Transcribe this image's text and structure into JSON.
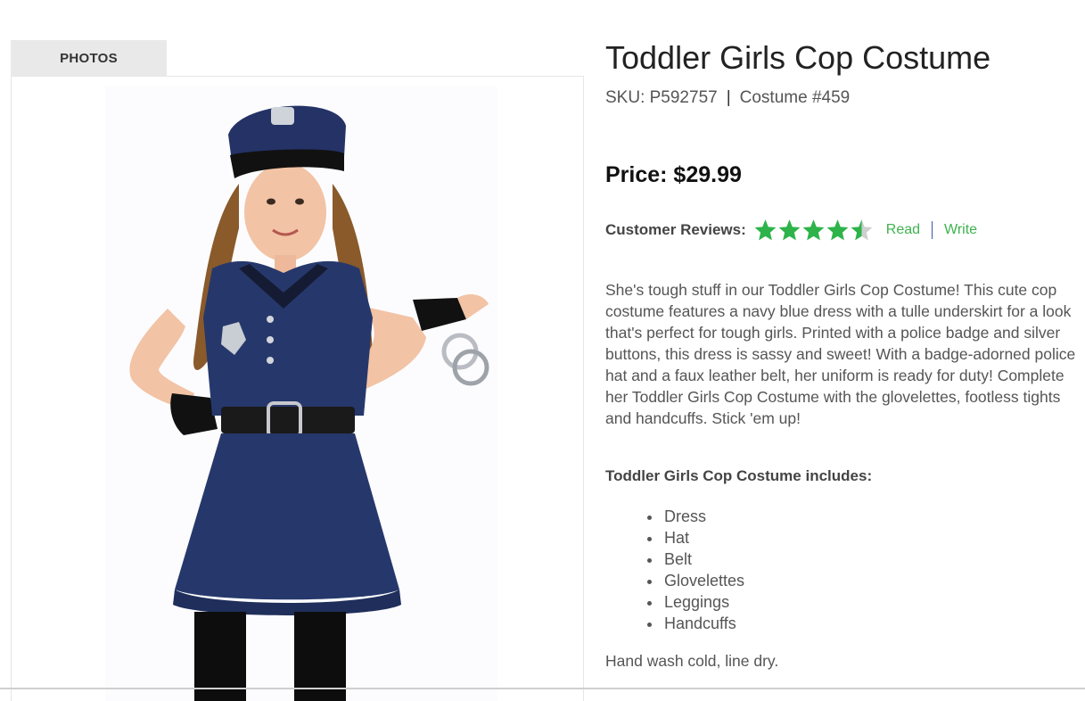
{
  "photos": {
    "tab_label": "PHOTOS",
    "image_alt": "Toddler Girls Cop Costume"
  },
  "product": {
    "title": "Toddler Girls Cop Costume",
    "sku": "SKU: P592757",
    "separator": "|",
    "costume_number": "Costume #459",
    "price_label": "Price: $29.99"
  },
  "reviews": {
    "label": "Customer Reviews:",
    "rating": 4.5,
    "max_rating": 5,
    "read_label": "Read",
    "write_label": "Write",
    "star_color": "#2db34a",
    "star_empty_color": "#cfcfcf"
  },
  "description": "She's tough stuff in our Toddler Girls Cop Costume! This cute cop costume features a navy blue dress with a tulle underskirt for a look that's perfect for tough girls. Printed with a police badge and silver buttons, this dress is sassy and sweet! With a badge-adorned police hat and a faux leather belt, her uniform is ready for duty! Complete her Toddler Girls Cop Costume with the glovelettes, footless tights and handcuffs. Stick 'em up!",
  "includes": {
    "heading": "Toddler Girls Cop Costume includes:",
    "items": [
      "Dress",
      "Hat",
      "Belt",
      "Glovelettes",
      "Leggings",
      "Handcuffs"
    ]
  },
  "care": "Hand wash cold, line dry.",
  "colors": {
    "link_green": "#3fb24f",
    "divider_blue": "#3d56a6",
    "dress_navy": "#26386b"
  }
}
